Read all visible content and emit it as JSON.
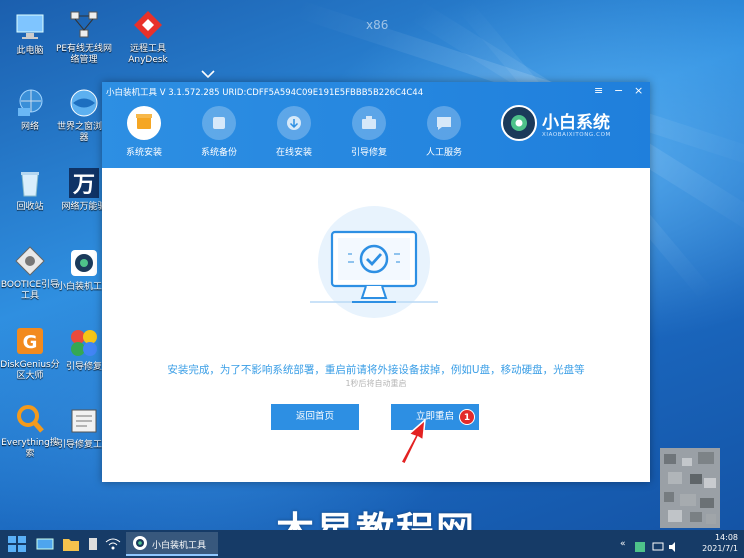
{
  "desktop": {
    "watermark_top": "x86",
    "icons": [
      {
        "label": "此电脑",
        "icon": "computer-icon"
      },
      {
        "label": "PE有线无线网络管理",
        "icon": "network-manager-icon"
      },
      {
        "label": "远程工具AnyDesk",
        "icon": "anydesk-icon"
      },
      {
        "label": "网络",
        "icon": "network-icon"
      },
      {
        "label": "世界之窗浏览器",
        "icon": "browser-icon"
      },
      {
        "label": "回收站",
        "icon": "recycle-bin-icon"
      },
      {
        "label": "网络万能驱",
        "icon": "driver-icon"
      },
      {
        "label": "BOOTICE引导工具",
        "icon": "bootice-icon"
      },
      {
        "label": "小白装机工具",
        "icon": "xiaobai-icon"
      },
      {
        "label": "DiskGenius分区大师",
        "icon": "diskgenius-icon"
      },
      {
        "label": "引导修复",
        "icon": "boot-repair-icon"
      },
      {
        "label": "Everything搜索",
        "icon": "everything-icon"
      },
      {
        "label": "引导修复工具",
        "icon": "boot-fix-tool-icon"
      }
    ]
  },
  "app": {
    "title": "小白装机工具 V 3.1.572.285 URID:CDFF5A594C09E191E5FBBB5B226C4C44",
    "controls": {
      "menu": "≡",
      "minimize": "−",
      "close": "×"
    },
    "nav": [
      {
        "label": "系统安装",
        "active": true
      },
      {
        "label": "系统备份",
        "active": false
      },
      {
        "label": "在线安装",
        "active": false
      },
      {
        "label": "引导修复",
        "active": false
      },
      {
        "label": "人工服务",
        "active": false
      }
    ],
    "brand": {
      "name": "小白系统",
      "domain": "XIAOBAIXITONG.COM"
    },
    "message": "安装完成，为了不影响系统部署，重启前请将外接设备拔掉，例如U盘，移动硬盘，光盘等",
    "countdown": "1秒后将自动重启",
    "buttons": {
      "back": "返回首页",
      "restart": "立即重启"
    },
    "badge": "1"
  },
  "overlay_watermark": "木星教程网",
  "taskbar": {
    "app_label": "小白装机工具",
    "time": "14:08",
    "date": "2021/7/1"
  },
  "colors": {
    "accent": "#2d8fe3",
    "badge": "#e22b2b",
    "message": "#3a9ee6"
  }
}
